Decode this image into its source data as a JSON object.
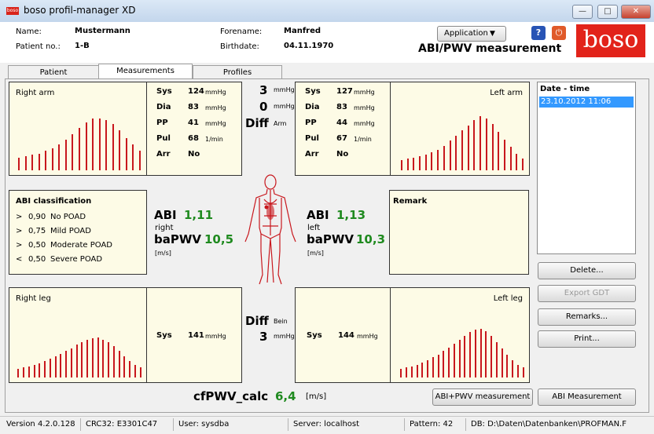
{
  "window": {
    "title": "boso profil-manager XD",
    "icon_label": "boso"
  },
  "header": {
    "name_label": "Name:",
    "name_value": "Mustermann",
    "patient_label": "Patient no.:",
    "patient_value": "1-B",
    "forename_label": "Forename:",
    "forename_value": "Manfred",
    "birthdate_label": "Birthdate:",
    "birthdate_value": "04.11.1970",
    "application_button": "Application",
    "page_title": "ABI/PWV measurement",
    "logo_text": "boso"
  },
  "tabs": [
    "Patient",
    "Measurements",
    "Profiles"
  ],
  "right_arm": {
    "title": "Right arm",
    "rows": [
      {
        "label": "Sys",
        "value": "124",
        "unit": "mmHg"
      },
      {
        "label": "Dia",
        "value": "83",
        "unit": "mmHg"
      },
      {
        "label": "PP",
        "value": "41",
        "unit": "mmHg"
      },
      {
        "label": "Pul",
        "value": "68",
        "unit": "1/min"
      },
      {
        "label": "Arr",
        "value": "No",
        "unit": ""
      }
    ],
    "bars": [
      0.2,
      0.22,
      0.24,
      0.26,
      0.3,
      0.34,
      0.4,
      0.48,
      0.56,
      0.66,
      0.74,
      0.8,
      0.8,
      0.78,
      0.72,
      0.62,
      0.5,
      0.4,
      0.3
    ]
  },
  "left_arm": {
    "title": "Left arm",
    "rows": [
      {
        "label": "Sys",
        "value": "127",
        "unit": "mmHg"
      },
      {
        "label": "Dia",
        "value": "83",
        "unit": "mmHg"
      },
      {
        "label": "PP",
        "value": "44",
        "unit": "mmHg"
      },
      {
        "label": "Pul",
        "value": "67",
        "unit": "1/min"
      },
      {
        "label": "Arr",
        "value": "No",
        "unit": ""
      }
    ],
    "bars": [
      0.16,
      0.18,
      0.2,
      0.22,
      0.24,
      0.28,
      0.32,
      0.38,
      0.46,
      0.54,
      0.62,
      0.7,
      0.78,
      0.84,
      0.8,
      0.72,
      0.6,
      0.48,
      0.36,
      0.26,
      0.18
    ]
  },
  "arm_diff": {
    "sys": "3",
    "dia": "0",
    "unit": "mmHg",
    "label": "Diff",
    "label2": "Arm"
  },
  "leg_diff": {
    "label": "Diff",
    "label2": "Bein",
    "value": "3",
    "unit": "mmHg"
  },
  "abi_classification": {
    "title": "ABI classification",
    "rows": [
      {
        "op": ">",
        "value": "0,90",
        "label": "No POAD"
      },
      {
        "op": ">",
        "value": "0,75",
        "label": "Mild POAD"
      },
      {
        "op": ">",
        "value": "0,50",
        "label": "Moderate POAD"
      },
      {
        "op": "<",
        "value": "0,50",
        "label": "Severe POAD"
      }
    ]
  },
  "right_results": {
    "abi_label": "ABI",
    "abi": "1,11",
    "side": "right",
    "pwv_label": "baPWV",
    "pwv": "10,5",
    "unit": "[m/s]"
  },
  "left_results": {
    "abi_label": "ABI",
    "abi": "1,13",
    "side": "left",
    "pwv_label": "baPWV",
    "pwv": "10,3",
    "unit": "[m/s]"
  },
  "remark": {
    "title": "Remark"
  },
  "right_leg": {
    "title": "Right leg",
    "sys_label": "Sys",
    "sys_value": "141",
    "unit": "mmHg",
    "bars": [
      0.14,
      0.16,
      0.18,
      0.2,
      0.22,
      0.26,
      0.3,
      0.34,
      0.38,
      0.42,
      0.46,
      0.52,
      0.56,
      0.6,
      0.62,
      0.64,
      0.6,
      0.56,
      0.5,
      0.42,
      0.34,
      0.26,
      0.2,
      0.16
    ]
  },
  "left_leg": {
    "title": "Left leg",
    "sys_label": "Sys",
    "sys_value": "144",
    "unit": "mmHg",
    "bars": [
      0.14,
      0.16,
      0.18,
      0.2,
      0.24,
      0.28,
      0.32,
      0.36,
      0.42,
      0.48,
      0.54,
      0.6,
      0.66,
      0.72,
      0.76,
      0.78,
      0.74,
      0.66,
      0.56,
      0.46,
      0.36,
      0.28,
      0.2,
      0.16
    ]
  },
  "cfpwv": {
    "label": "cfPWV_calc",
    "value": "6,4",
    "unit": "[m/s]"
  },
  "date_list": {
    "header": "Date - time",
    "items": [
      "23.10.2012 11:06"
    ]
  },
  "buttons": {
    "delete": "Delete...",
    "export_gdt": "Export GDT",
    "remarks": "Remarks...",
    "print": "Print...",
    "abi_pwv": "ABI+PWV measurement",
    "abi": "ABI Measurement"
  },
  "status": {
    "version": "Version 4.2.0.128",
    "crc": "CRC32: E3301C47",
    "user": "User: sysdba",
    "server": "Server: localhost",
    "pattern": "Pattern: 42",
    "db": "DB: D:\\Daten\\Datenbanken\\PROFMAN.F"
  },
  "colors": {
    "accent": "#c8171d",
    "panel_bg": "#fdfbe6",
    "selection": "#3399ff",
    "value_green": "#1f8a1f",
    "logo_red": "#e2231a"
  }
}
